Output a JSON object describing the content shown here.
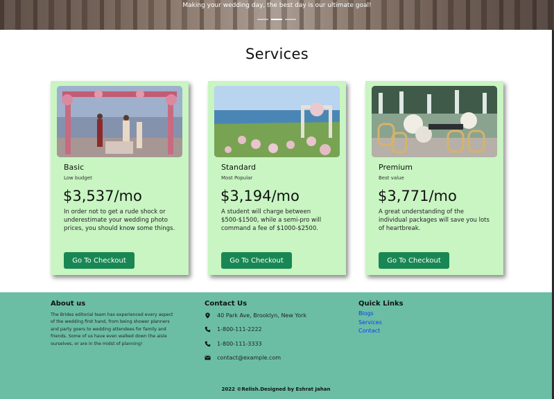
{
  "hero": {
    "caption": "Making your wedding day, the best day is our ultimate goal!",
    "indicators": 3,
    "active_indicator": 2
  },
  "services": {
    "title": "Services",
    "cards": [
      {
        "title": "Basic",
        "subtitle": "Low budget",
        "price": "$3,537/mo",
        "description": "In order not to get a rude shock or underestimate your wedding photo prices, you should know some things.",
        "button": "Go To Checkout"
      },
      {
        "title": "Standard",
        "subtitle": "Most Popular",
        "price": "$3,194/mo",
        "description": "A student will charge between $500-$1500, while a semi-pro will command a fee of $1000-$2500.",
        "button": "Go To Checkout"
      },
      {
        "title": "Premium",
        "subtitle": "Best value",
        "price": "$3,771/mo",
        "description": "A great understanding of the individual packages will save you lots of heartbreak.",
        "button": "Go To Checkout"
      }
    ]
  },
  "footer": {
    "about": {
      "title": "About us",
      "text": "The Brides editorial team has experienced every aspect of the wedding first hand, from being shower planners and party goers to wedding attendees for family and friends. Some of us have even walked down the aisle ourselves, or are in the midst of planning!"
    },
    "contact": {
      "title": "Contact Us",
      "address": "40 Park Ave, Brooklyn, New York",
      "phone1": "1-800-111-2222",
      "phone2": "1-800-111-3333",
      "email": "contact@example.com"
    },
    "quick_links": {
      "title": "Quick Links",
      "items": [
        "Blogs",
        "Services",
        "Contact"
      ]
    },
    "copyright": "2022 ©Relish.Designed by Eshrat Jahan"
  },
  "colors": {
    "card_bg": "#c8f5c2",
    "button_bg": "#198754",
    "footer_bg": "#6bbea4",
    "link": "#0d3cf0"
  }
}
